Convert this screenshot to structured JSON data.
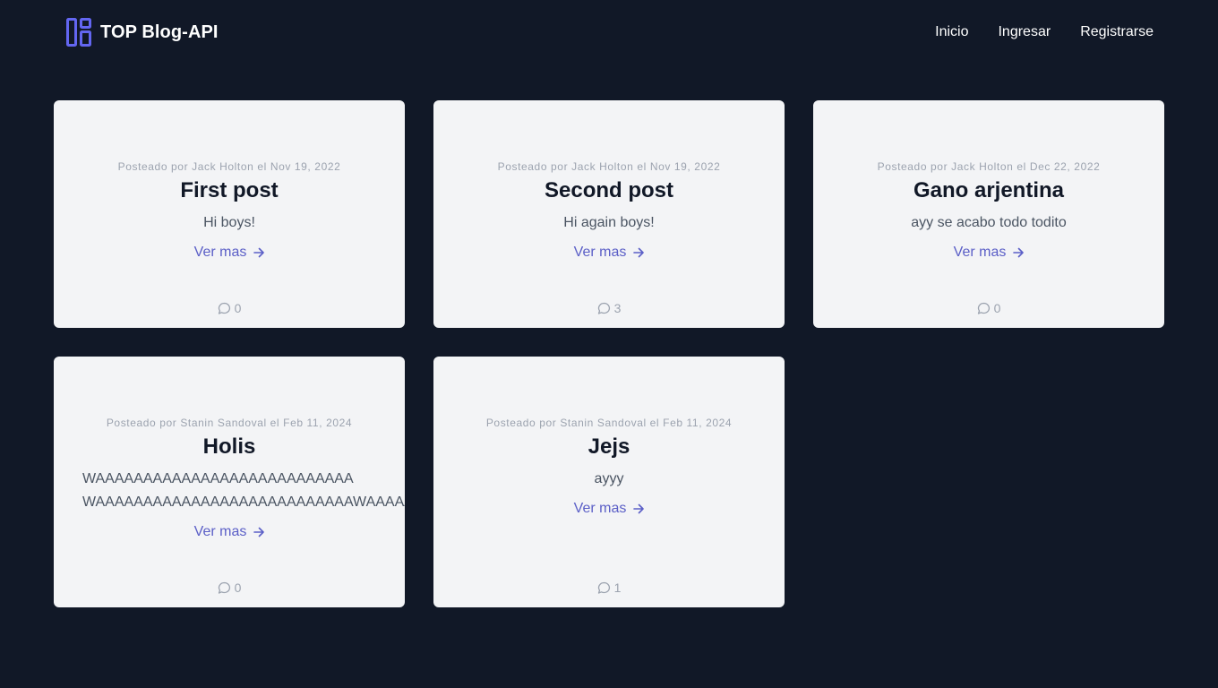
{
  "nav": {
    "brand": "TOP Blog-API",
    "links": [
      "Inicio",
      "Ingresar",
      "Registrarse"
    ]
  },
  "colors": {
    "background": "#111827",
    "card": "#f3f4f6",
    "accent": "#5b5fc7",
    "logo": "#6366f1"
  },
  "icons": {
    "logo": "layout-grid-icon",
    "more": "arrow-right-icon",
    "comments": "comment-bubble-icon"
  },
  "posts": [
    {
      "meta": "Posteado por Jack Holton el Nov 19, 2022",
      "title": "First post",
      "excerpt": "Hi boys!",
      "more": "Ver mas",
      "comments": "0"
    },
    {
      "meta": "Posteado por Jack Holton el Nov 19, 2022",
      "title": "Second post",
      "excerpt": "Hi again boys!",
      "more": "Ver mas",
      "comments": "3"
    },
    {
      "meta": "Posteado por Jack Holton el Dec 22, 2022",
      "title": "Gano arjentina",
      "excerpt": "ayy se acabo todo todito",
      "more": "Ver mas",
      "comments": "0"
    },
    {
      "meta": "Posteado por Stanin Sandoval el Feb 11, 2024",
      "title": "Holis",
      "excerpt": "WAAAAAAAAAAAAAAAAAAAAAAAAAAA\nWAAAAAAAAAAAAAAAAAAAAAAAAAAAWAAAAAAA",
      "more": "Ver mas",
      "comments": "0"
    },
    {
      "meta": "Posteado por Stanin Sandoval el Feb 11, 2024",
      "title": "Jejs",
      "excerpt": "ayyy",
      "more": "Ver mas",
      "comments": "1"
    }
  ]
}
